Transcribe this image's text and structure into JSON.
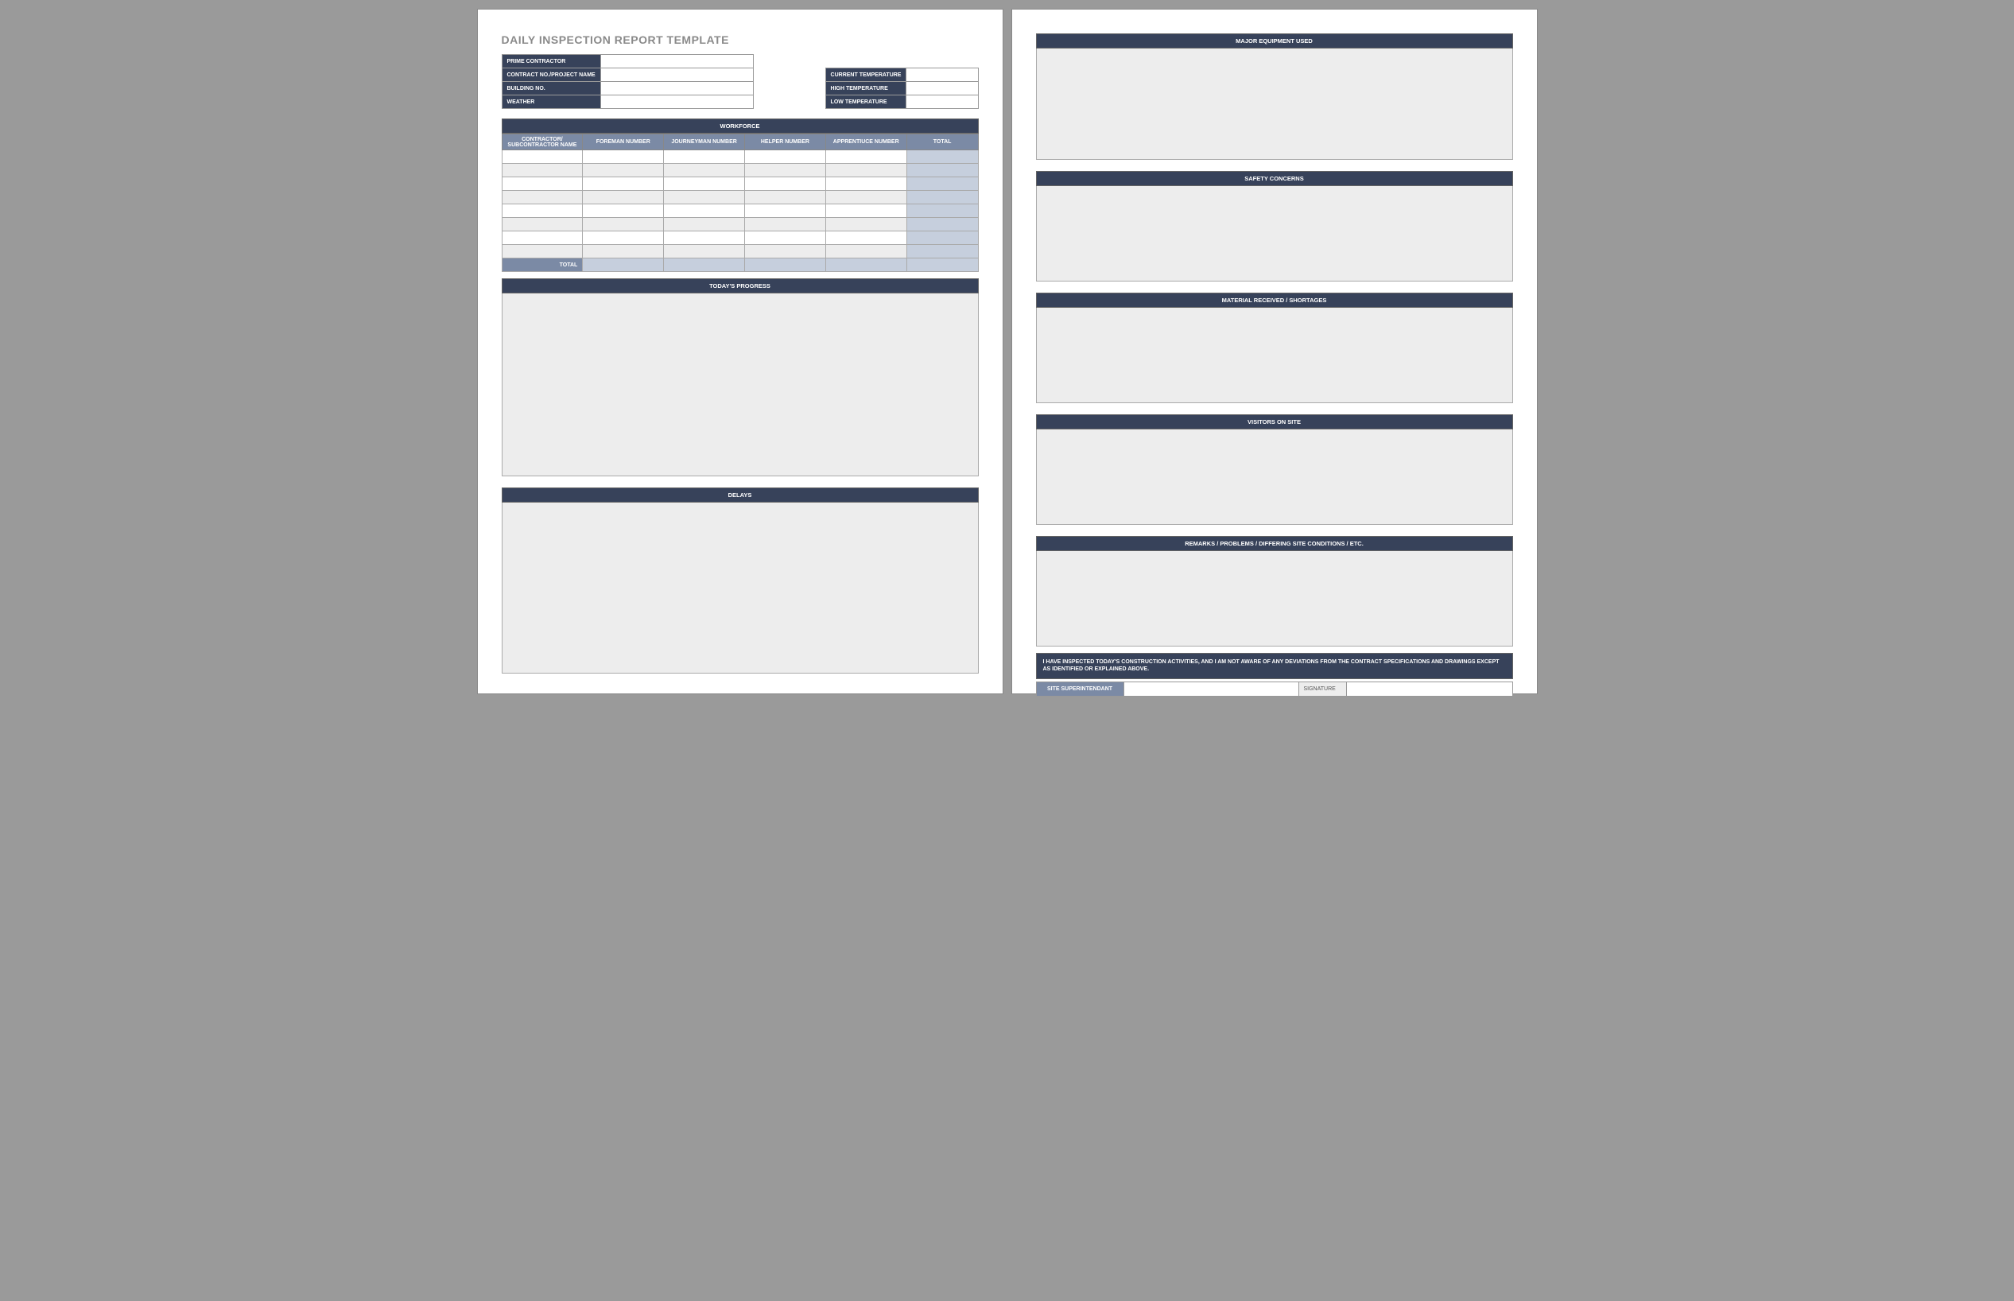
{
  "document": {
    "title": "DAILY INSPECTION REPORT TEMPLATE"
  },
  "project_info": {
    "prime_contractor_label": "PRIME CONTRACTOR",
    "prime_contractor_value": "",
    "contract_no_label": "CONTRACT NO./PROJECT NAME",
    "contract_no_value": "",
    "building_no_label": "BUILDING NO.",
    "building_no_value": "",
    "weather_label": "WEATHER",
    "weather_value": ""
  },
  "temperature": {
    "current_label": "CURRENT TEMPERATURE",
    "current_value": "",
    "high_label": "HIGH TEMPERATURE",
    "high_value": "",
    "low_label": "LOW TEMPERATURE",
    "low_value": ""
  },
  "workforce": {
    "header": "WORKFORCE",
    "columns": {
      "contractor": "CONTRACTOR/\nSUBCONTRACTOR NAME",
      "foreman": "FOREMAN NUMBER",
      "journeyman": "JOURNEYMAN NUMBER",
      "helper": "HELPER NUMBER",
      "apprentice": "APPRENTIUCE NUMBER",
      "total": "TOTAL"
    },
    "total_label": "TOTAL",
    "rows": [
      {
        "contractor": "",
        "foreman": "",
        "journeyman": "",
        "helper": "",
        "apprentice": "",
        "total": ""
      },
      {
        "contractor": "",
        "foreman": "",
        "journeyman": "",
        "helper": "",
        "apprentice": "",
        "total": ""
      },
      {
        "contractor": "",
        "foreman": "",
        "journeyman": "",
        "helper": "",
        "apprentice": "",
        "total": ""
      },
      {
        "contractor": "",
        "foreman": "",
        "journeyman": "",
        "helper": "",
        "apprentice": "",
        "total": ""
      },
      {
        "contractor": "",
        "foreman": "",
        "journeyman": "",
        "helper": "",
        "apprentice": "",
        "total": ""
      },
      {
        "contractor": "",
        "foreman": "",
        "journeyman": "",
        "helper": "",
        "apprentice": "",
        "total": ""
      },
      {
        "contractor": "",
        "foreman": "",
        "journeyman": "",
        "helper": "",
        "apprentice": "",
        "total": ""
      },
      {
        "contractor": "",
        "foreman": "",
        "journeyman": "",
        "helper": "",
        "apprentice": "",
        "total": ""
      }
    ],
    "totals": {
      "foreman": "",
      "journeyman": "",
      "helper": "",
      "apprentice": "",
      "total": ""
    }
  },
  "sections": {
    "progress": "TODAY'S PROGRESS",
    "delays": "DELAYS",
    "equipment": "MAJOR EQUIPMENT USED",
    "safety": "SAFETY CONCERNS",
    "material": "MATERIAL RECEIVED / SHORTAGES",
    "visitors": "VISITORS ON SITE",
    "remarks": "REMARKS / PROBLEMS / DIFFERING SITE CONDITIONS / ETC."
  },
  "declaration": "I HAVE INSPECTED TODAY'S CONSTRUCTION ACTIVITIES, AND I AM NOT AWARE OF ANY DEVIATIONS FROM THE CONTRACT SPECIFICATIONS AND DRAWINGS EXCEPT AS IDENTIFIED OR EXPLAINED ABOVE.",
  "signature": {
    "superintendant_label": "SITE SUPERINTENDANT",
    "superintendant_value": "",
    "signature_label": "SIGNATURE",
    "signature_value": ""
  }
}
